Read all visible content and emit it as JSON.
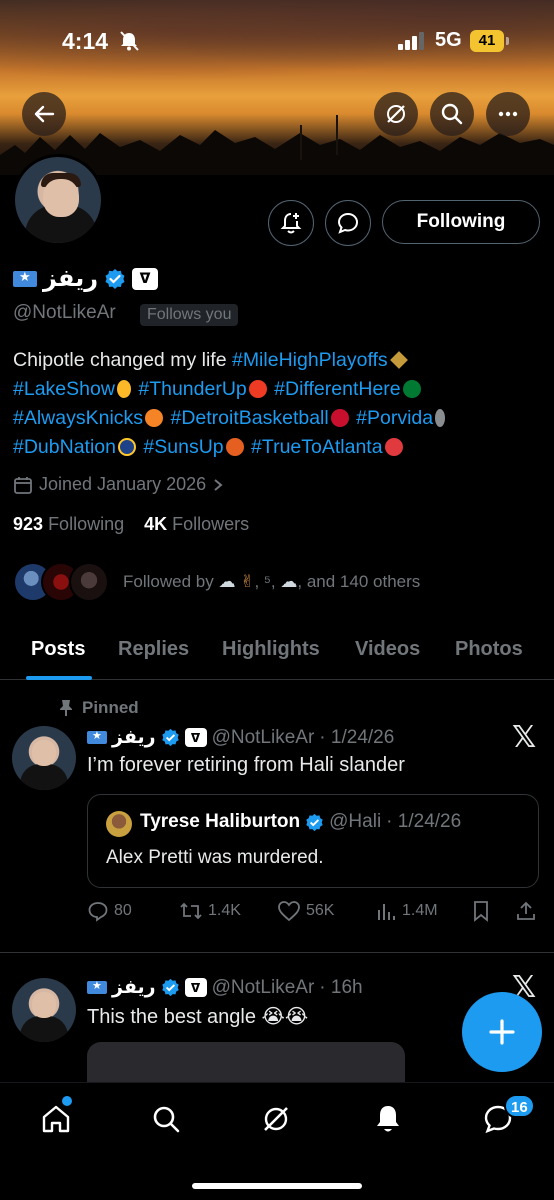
{
  "status_bar": {
    "time": "4:14",
    "network": "5G",
    "battery": "41"
  },
  "profile": {
    "name": "ريفز",
    "affiliate_badge": "ᐁ",
    "handle": "@NotLikeAr",
    "follows_you": "Follows you",
    "follow_button": "Following",
    "bio_segments": [
      {
        "text": "Chipotle changed my life ",
        "type": "text"
      },
      {
        "text": "#MileHighPlayoffs",
        "type": "tag"
      },
      {
        "text": "#LakeShow",
        "type": "tag"
      },
      {
        "text": "#ThunderUp",
        "type": "tag"
      },
      {
        "text": "#DifferentHere",
        "type": "tag"
      },
      {
        "text": "#AlwaysKnicks",
        "type": "tag"
      },
      {
        "text": "#DetroitBasketball",
        "type": "tag"
      },
      {
        "text": "#Porvida",
        "type": "tag"
      },
      {
        "text": "#DubNation",
        "type": "tag"
      },
      {
        "text": "#SunsUp",
        "type": "tag"
      },
      {
        "text": "#TrueToAtlanta",
        "type": "tag"
      }
    ],
    "joined": "Joined January 2026",
    "following_count": "923",
    "following_label": "Following",
    "followers_count": "4K",
    "followers_label": "Followers",
    "followed_by_prefix": "Followed by",
    "followed_by_mid": ", ⁵, ",
    "followed_by_suffix": ", and 140 others"
  },
  "tabs": [
    "Posts",
    "Replies",
    "Highlights",
    "Videos",
    "Photos"
  ],
  "posts": [
    {
      "pinned_label": "Pinned",
      "name": "ريفز",
      "affiliate_badge": "ᐁ",
      "handle": "@NotLikeAr",
      "time": "· 1/24/26",
      "text": "I’m forever retiring from Hali slander",
      "quote": {
        "name": "Tyrese Haliburton",
        "handle": "@Hali",
        "time": "· 1/24/26",
        "text": "Alex Pretti was murdered."
      },
      "replies": "80",
      "reposts": "1.4K",
      "likes": "56K",
      "views": "1.4M"
    },
    {
      "name": "ريفز",
      "affiliate_badge": "ᐁ",
      "handle": "@NotLikeAr",
      "time": "· 16h",
      "text": "This the best angle 😭😭"
    }
  ],
  "nav": {
    "messages_badge": "16"
  },
  "colors": {
    "accent": "#1d9bf0",
    "muted": "#71767b",
    "background": "#000000"
  }
}
